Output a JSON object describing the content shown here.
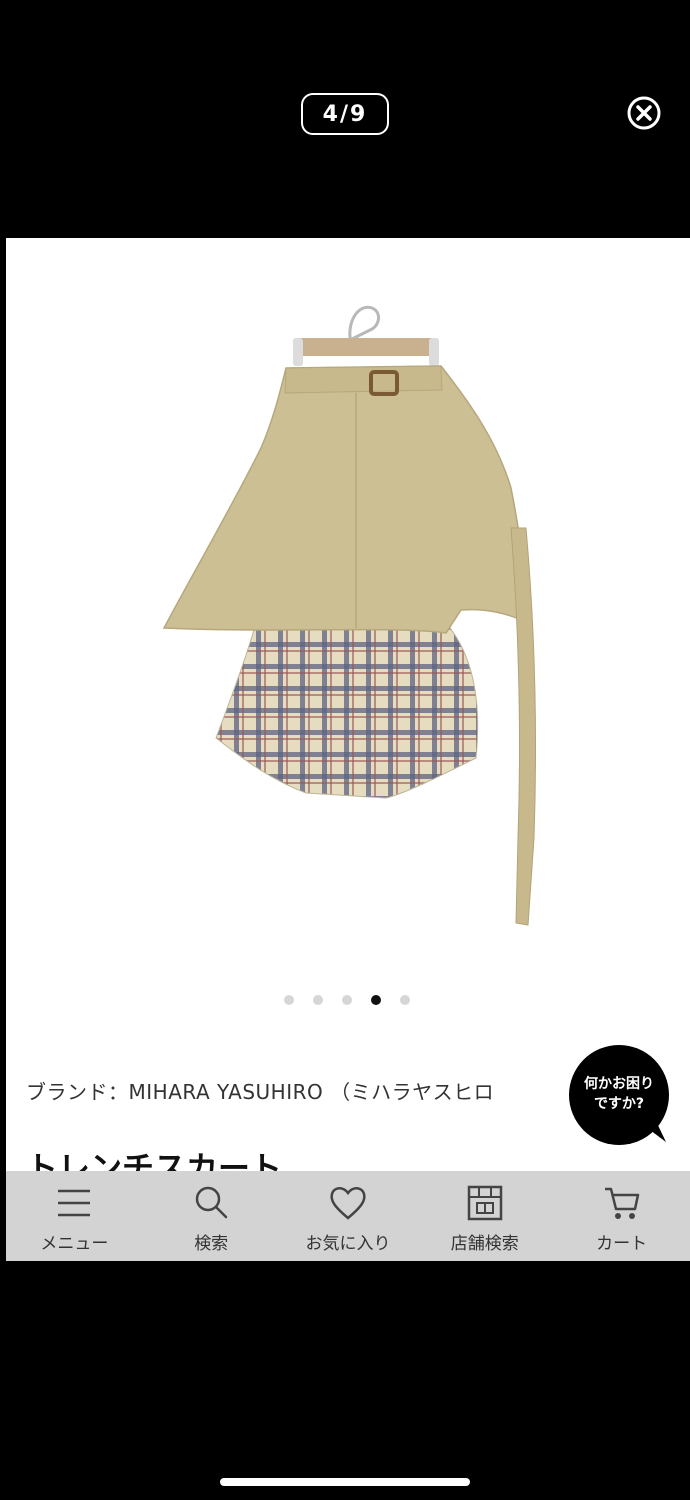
{
  "viewer": {
    "counter": "4/9"
  },
  "carousel": {
    "total": 5,
    "active_index": 3
  },
  "product": {
    "brand_line": "ブランド：MIHARA YASUHIRO （ミハラヤスヒロ",
    "title": "トレンチスカート"
  },
  "help": {
    "line1": "何かお困り",
    "line2": "ですか?"
  },
  "tabbar": {
    "items": [
      {
        "label": "メニュー",
        "icon": "menu-icon"
      },
      {
        "label": "検索",
        "icon": "search-icon"
      },
      {
        "label": "お気に入り",
        "icon": "heart-icon"
      },
      {
        "label": "店舗検索",
        "icon": "store-icon"
      },
      {
        "label": "カート",
        "icon": "cart-icon"
      }
    ]
  },
  "colors": {
    "tabbar_bg": "#d3d3d3",
    "background": "#000000",
    "help_bubble": "#000000"
  }
}
